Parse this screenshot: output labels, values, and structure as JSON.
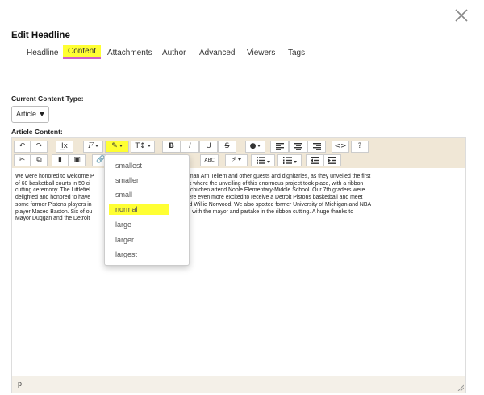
{
  "dialog": {
    "title": "Edit Headline",
    "tabs": [
      {
        "label": "Headline"
      },
      {
        "label": "Content"
      },
      {
        "label": "Attachments"
      },
      {
        "label": "Author"
      },
      {
        "label": "Advanced"
      },
      {
        "label": "Viewers"
      },
      {
        "label": "Tags"
      }
    ],
    "active_tab": "Content"
  },
  "content_type": {
    "label": "Current Content Type:",
    "value": "Article"
  },
  "article": {
    "label": "Article Content:",
    "text_lines": [
      "We were honored to welcome P                              t Pistons Vice Chairman Arn Tellem and other guests and dignitaries, as they unveiled the first",
      "of 60 basketball courts in 50 ci                              Park was the first park where the unveiling of this enormous project took place, with a ribbon",
      "cutting ceremony. The Littlefiel                              here a majority of the children attend Noble Elementary-Middle School. Our 7th graders were",
      "delighted and honored to have                              he festivities. They were even more excited to receive a Detroit Pistons basketball and meet",
      "some former Pistons players in                              ton, Rick Mahorn, and Willie Norwood. We also spotted former University of Michigan and NBA",
      "player Maceo Baston. Six of ou                              ted to stand on stage with the mayor and partake in the ribbon cutting. A huge thanks to",
      "Mayor Duggan and the Detroit"
    ],
    "status_path": "p"
  },
  "toolbar": {
    "undo_icon": "↶",
    "redo_icon": "↷",
    "clear_format_icon": "I̲x",
    "font_icon": "F",
    "color_icon": "✎",
    "size_icon": "T↕",
    "bold": "B",
    "italic": "I",
    "underline": "U",
    "strike": "S",
    "fill_icon": "●",
    "code_icon": "<>",
    "help_icon": "?",
    "cut_icon": "✂",
    "copy_icon": "⧉",
    "paste_icon": "▮",
    "paste_word_icon": "▣",
    "link_icon": "🔗",
    "spell_icon": "ABC",
    "lightning_icon": "⚡"
  },
  "font_size_menu": {
    "options": [
      "smallest",
      "smaller",
      "small",
      "normal",
      "large",
      "larger",
      "largest"
    ],
    "selected": "normal"
  }
}
